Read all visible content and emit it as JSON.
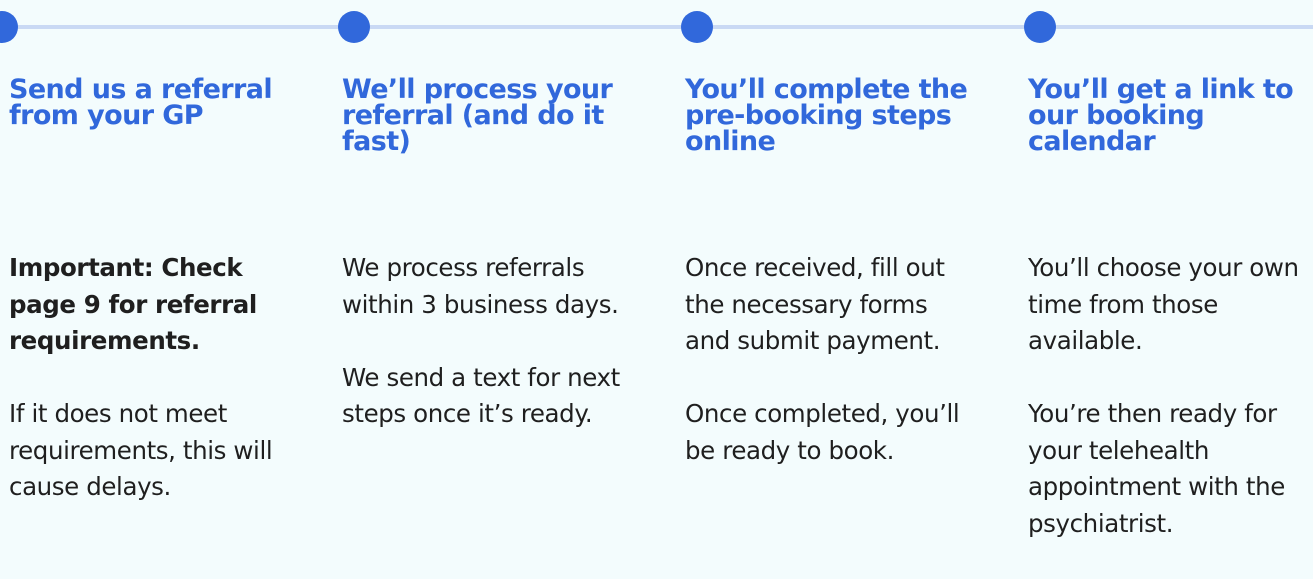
{
  "steps": [
    {
      "heading": "Send us a referral from your GP",
      "paragraphs": [
        "Important: Check page 9 for referral requirements.",
        "If it does not meet requirements, this will cause delays."
      ]
    },
    {
      "heading": "We’ll process your referral (and do it fast)",
      "paragraphs": [
        "We process referrals within 3 business days.",
        "We send a text for next steps once it’s ready."
      ]
    },
    {
      "heading": "You’ll complete the pre-booking steps online",
      "paragraphs": [
        "Once received, fill out the necessary forms and submit payment.",
        "Once completed, you’ll be ready to book."
      ]
    },
    {
      "heading": "You’ll get a link to our booking calendar",
      "paragraphs": [
        "You’ll choose your own time from those available.",
        "You’re then ready for your telehealth appointment with the psychiatrist."
      ]
    }
  ],
  "colors": {
    "accent": "#3168db",
    "line": "#c9d9f4",
    "background": "#f3fcfd",
    "text": "#1f1f1f"
  }
}
